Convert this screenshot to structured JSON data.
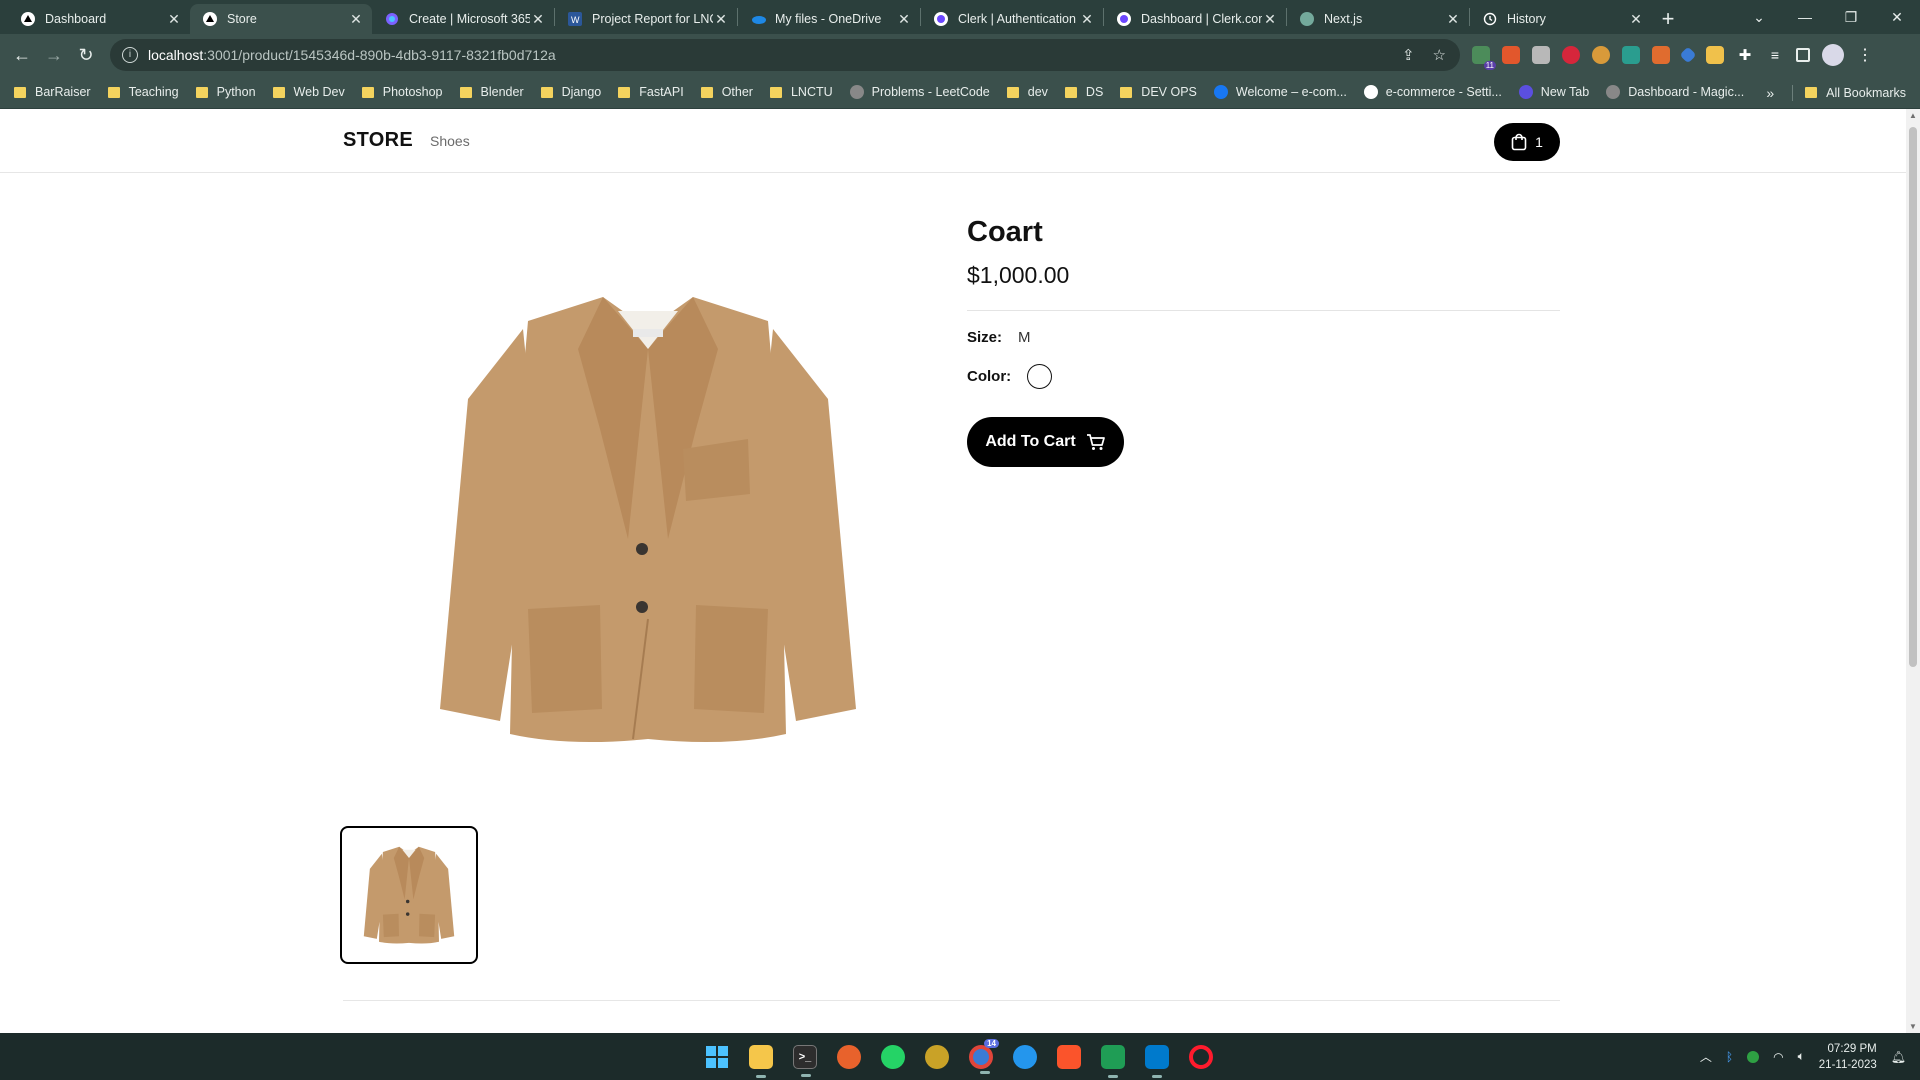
{
  "browser": {
    "tabs": [
      {
        "title": "Dashboard",
        "icon": "triangle-icon",
        "active": false
      },
      {
        "title": "Store",
        "icon": "triangle-icon",
        "active": true
      },
      {
        "title": "Create | Microsoft 365",
        "icon": "copilot-icon",
        "active": false
      },
      {
        "title": "Project Report for LNCTU",
        "icon": "word-icon",
        "active": false
      },
      {
        "title": "My files - OneDrive",
        "icon": "onedrive-icon",
        "active": false
      },
      {
        "title": "Clerk | Authentication",
        "icon": "clerk-icon",
        "active": false
      },
      {
        "title": "Dashboard | Clerk.com",
        "icon": "clerk-icon",
        "active": false
      },
      {
        "title": "Next.js",
        "icon": "chatgpt-icon",
        "active": false
      },
      {
        "title": "History",
        "icon": "history-icon",
        "active": false
      }
    ],
    "address": {
      "host": "localhost",
      "path": ":3001/product/1545346d-890b-4db3-9117-8321fb0d712a"
    },
    "bookmarks": [
      {
        "label": "BarRaiser",
        "type": "folder"
      },
      {
        "label": "Teaching",
        "type": "folder"
      },
      {
        "label": "Python",
        "type": "folder"
      },
      {
        "label": "Web Dev",
        "type": "folder"
      },
      {
        "label": "Photoshop",
        "type": "folder"
      },
      {
        "label": "Blender",
        "type": "folder"
      },
      {
        "label": "Django",
        "type": "folder"
      },
      {
        "label": "FastAPI",
        "type": "folder"
      },
      {
        "label": "Other",
        "type": "folder"
      },
      {
        "label": "LNCTU",
        "type": "folder"
      },
      {
        "label": "Problems - LeetCode",
        "type": "link"
      },
      {
        "label": "dev",
        "type": "folder"
      },
      {
        "label": "DS",
        "type": "folder"
      },
      {
        "label": "DEV OPS",
        "type": "folder"
      },
      {
        "label": "Welcome – e-com...",
        "type": "link"
      },
      {
        "label": "e-commerce - Setti...",
        "type": "link"
      },
      {
        "label": "New Tab",
        "type": "link"
      },
      {
        "label": "Dashboard - Magic...",
        "type": "link"
      }
    ],
    "all_bookmarks": "All Bookmarks",
    "extension_badge": "11"
  },
  "site": {
    "logo": "STORE",
    "nav": [
      "Shoes"
    ],
    "cart_count": "1"
  },
  "product": {
    "name": "Coart",
    "price": "$1,000.00",
    "size_label": "Size:",
    "size_value": "M",
    "color_label": "Color:",
    "color_value": "#ffffff",
    "add_to_cart": "Add To Cart",
    "image_color": "#c49a6c"
  },
  "taskbar": {
    "time": "07:29 PM",
    "date": "21-11-2023",
    "chrome_badge": "14"
  }
}
